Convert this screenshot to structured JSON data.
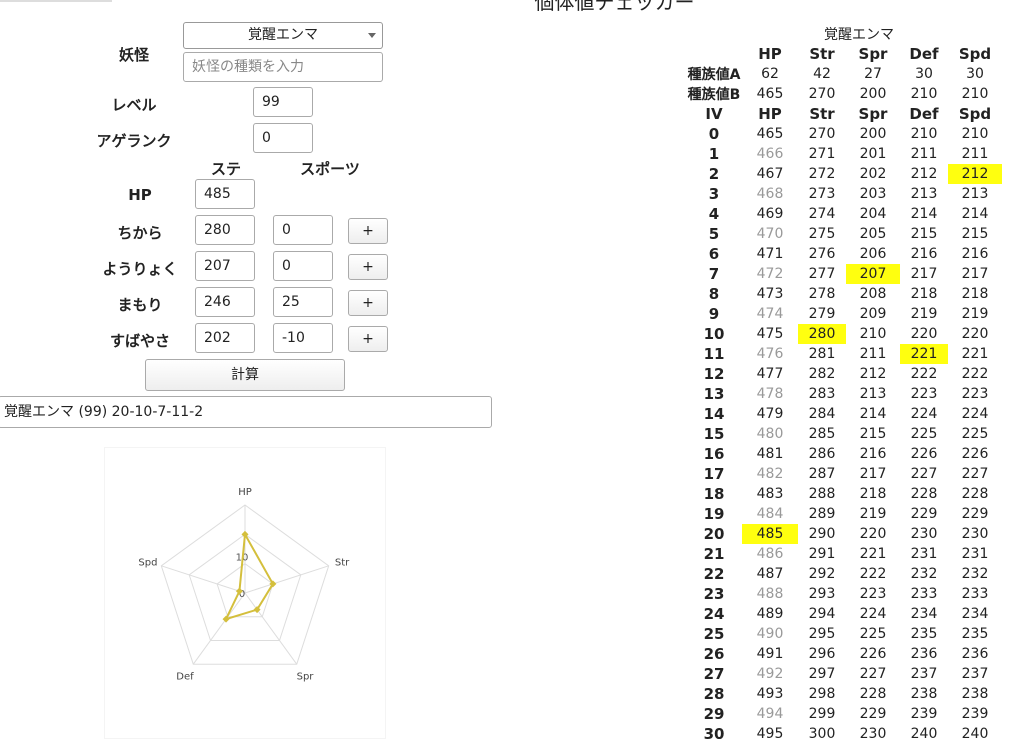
{
  "app_title": "個体値チェッカー",
  "form": {
    "youkai_label": "妖怪",
    "youkai_selected": "覚醒エンマ",
    "youkai_search_placeholder": "妖怪の種類を入力",
    "level_label": "レベル",
    "level_value": "99",
    "ageranku_label": "アゲランク",
    "ageranku_value": "0",
    "col_stat": "ステ",
    "col_sports": "スポーツ",
    "rows": [
      {
        "label": "HP",
        "stat": "485",
        "sports": null
      },
      {
        "label": "ちから",
        "stat": "280",
        "sports": "0",
        "plus": "+"
      },
      {
        "label": "ようりょく",
        "stat": "207",
        "sports": "0",
        "plus": "+"
      },
      {
        "label": "まもり",
        "stat": "246",
        "sports": "25",
        "plus": "+"
      },
      {
        "label": "すばやさ",
        "stat": "202",
        "sports": "-10",
        "plus": "+"
      }
    ],
    "calc_button": "計算",
    "result": "覚醒エンマ (99) 20-10-7-11-2"
  },
  "radar": {
    "axes": [
      "HP",
      "Str",
      "Spr",
      "Def",
      "Spd"
    ],
    "values": [
      20,
      10,
      7,
      11,
      2
    ],
    "ticks": [
      "0",
      "10"
    ],
    "max": 30,
    "color": "#d4bf3c"
  },
  "table": {
    "name": "覚醒エンマ",
    "stat_headers": [
      "HP",
      "Str",
      "Spr",
      "Def",
      "Spd"
    ],
    "base_a_label": "種族値A",
    "base_a": [
      "62",
      "42",
      "27",
      "30",
      "30"
    ],
    "base_b_label": "種族値B",
    "base_b": [
      "465",
      "270",
      "200",
      "210",
      "210"
    ],
    "iv_headers": [
      "IV",
      "HP",
      "Str",
      "Spr",
      "Def",
      "Spd"
    ],
    "highlight": {
      "HP": 20,
      "Str": 10,
      "Spr": 7,
      "Def": 11,
      "Spd": 2
    },
    "highlight_color": "#ffff0f"
  }
}
